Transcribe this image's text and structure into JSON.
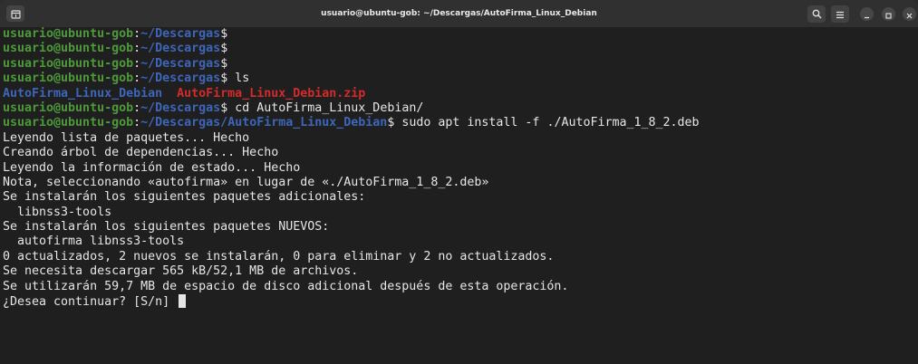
{
  "window": {
    "title": "usuario@ubuntu-gob: ~/Descargas/AutoFirma_Linux_Debian"
  },
  "icons": {
    "new_tab": "new-tab-icon",
    "search": "search-icon",
    "menu": "hamburger-menu-icon",
    "minimize": "minimize-icon",
    "maximize": "maximize-icon",
    "close": "close-icon"
  },
  "colors": {
    "user_host": "#4e9a3a",
    "path": "#3e66b8",
    "zip_file": "#d22b2b",
    "text": "#e6e6e6",
    "background": "#1f1f1f"
  },
  "terminal": {
    "prompt_user": "usuario@ubuntu-gob",
    "prompt_colon": ":",
    "prompt_path_home": "~/Descargas",
    "prompt_path_sub": "~/Descargas/AutoFirma_Linux_Debian",
    "prompt_symbol": "$",
    "cmd_ls": " ls",
    "ls_dir": "AutoFirma_Linux_Debian",
    "ls_zip": "AutoFirma_Linux_Debian.zip",
    "cmd_cd": " cd AutoFirma_Linux_Debian/",
    "cmd_install": " sudo apt install -f ./AutoFirma_1_8_2.deb",
    "output": [
      "Leyendo lista de paquetes... Hecho",
      "Creando árbol de dependencias... Hecho",
      "Leyendo la información de estado... Hecho",
      "Nota, seleccionando «autofirma» en lugar de «./AutoFirma_1_8_2.deb»",
      "Se instalarán los siguientes paquetes adicionales:",
      "  libnss3-tools",
      "Se instalarán los siguientes paquetes NUEVOS:",
      "  autofirma libnss3-tools",
      "0 actualizados, 2 nuevos se instalarán, 0 para eliminar y 2 no actualizados.",
      "Se necesita descargar 565 kB/52,1 MB de archivos.",
      "Se utilizarán 59,7 MB de espacio de disco adicional después de esta operación."
    ],
    "question": "¿Desea continuar? [S/n] "
  }
}
